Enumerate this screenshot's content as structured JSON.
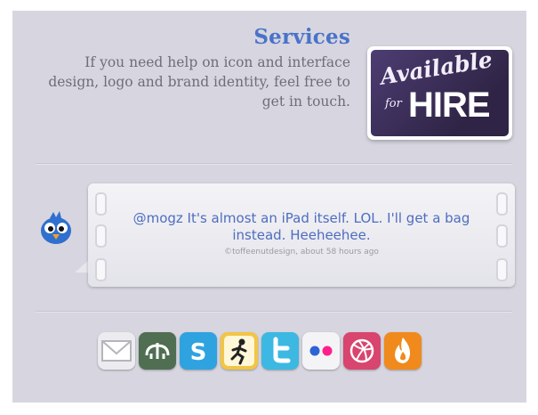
{
  "services": {
    "title": "Services",
    "description": "If you need help on icon and interface design, logo and brand identity, feel free to get in touch."
  },
  "hire_badge": {
    "line1": "Available",
    "line2_small": "for",
    "line2_big": "HIRE"
  },
  "tweet": {
    "text": "@mogz It's almost an iPad itself. LOL. I'll get a bag instead. Heeheehee.",
    "meta": "©toffeenutdesign, about 58 hours ago"
  },
  "social_icons": [
    {
      "name": "email-icon",
      "color": "#e8e8ec"
    },
    {
      "name": "deviantart-icon",
      "color": "#4f6e52"
    },
    {
      "name": "skype-icon",
      "color": "#2ea3e0"
    },
    {
      "name": "runner-icon",
      "color": "#e7b33a"
    },
    {
      "name": "twitter-icon",
      "color": "#3cb8e3"
    },
    {
      "name": "flickr-icon",
      "color": "#ffffff"
    },
    {
      "name": "dribbble-icon",
      "color": "#d8456f"
    },
    {
      "name": "fire-icon",
      "color": "#f08a1d"
    }
  ],
  "colors": {
    "background": "#d7d6e0",
    "title_blue": "#4a72c8",
    "body_gray": "#6e6e78",
    "badge_purple": "#3b2f57"
  }
}
